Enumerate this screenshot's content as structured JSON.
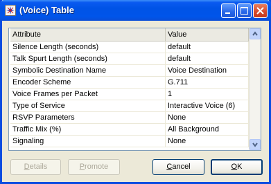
{
  "window": {
    "title": "(Voice) Table"
  },
  "table": {
    "headers": [
      "Attribute",
      "Value"
    ],
    "rows": [
      [
        "Silence Length (seconds)",
        "default"
      ],
      [
        "Talk Spurt Length (seconds)",
        "default"
      ],
      [
        "Symbolic Destination Name",
        "Voice Destination"
      ],
      [
        "Encoder Scheme",
        "G.711"
      ],
      [
        "Voice Frames per Packet",
        "1"
      ],
      [
        "Type of Service",
        "Interactive Voice (6)"
      ],
      [
        "RSVP Parameters",
        "None"
      ],
      [
        "Traffic Mix (%)",
        "All Background"
      ],
      [
        "Signaling",
        "None"
      ]
    ]
  },
  "buttons": {
    "details": {
      "label": "Details",
      "mnemonic": "D",
      "rest": "etails"
    },
    "promote": {
      "label": "Promote",
      "mnemonic": "P",
      "rest": "romote"
    },
    "cancel": {
      "label": "Cancel",
      "mnemonic": "C",
      "rest": "ancel"
    },
    "ok": {
      "label": "OK",
      "mnemonic": "O",
      "rest": "K"
    }
  }
}
